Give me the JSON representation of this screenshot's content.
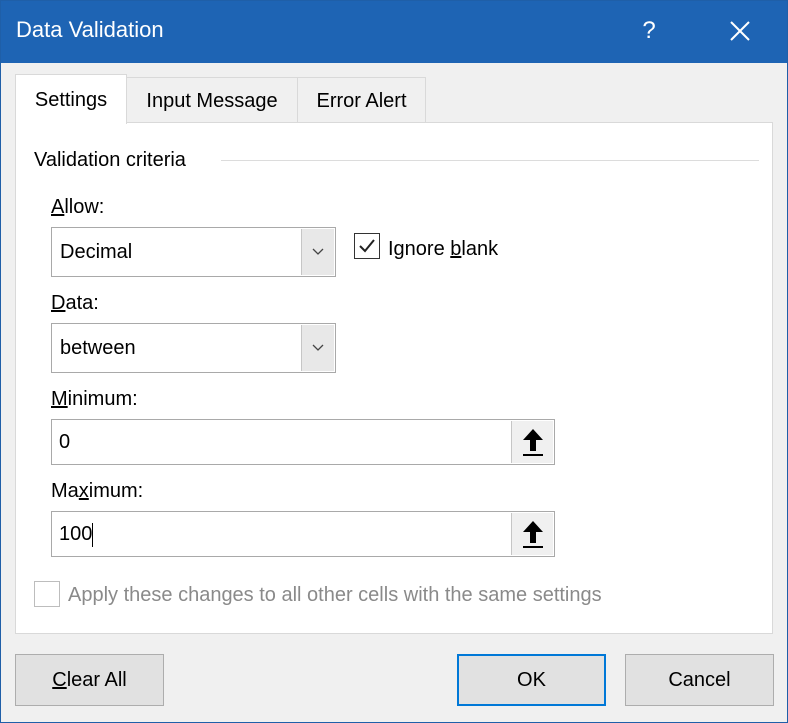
{
  "window": {
    "title": "Data Validation",
    "help_label": "?",
    "close_icon": "close-icon"
  },
  "tabs": [
    {
      "label": "Settings",
      "active": true
    },
    {
      "label": "Input Message",
      "active": false
    },
    {
      "label": "Error Alert",
      "active": false
    }
  ],
  "settings": {
    "group_label": "Validation criteria",
    "allow": {
      "label_u": "A",
      "label_rest": "llow:",
      "value": "Decimal"
    },
    "ignore_blank": {
      "label_pre": "Ignore ",
      "label_u": "b",
      "label_post": "lank",
      "checked": true
    },
    "data": {
      "label_u": "D",
      "label_rest": "ata:",
      "value": "between"
    },
    "minimum": {
      "label_u": "M",
      "label_rest": "inimum:",
      "value": "0"
    },
    "maximum": {
      "label_pre": "Ma",
      "label_u": "x",
      "label_post": "imum:",
      "value": "100"
    },
    "apply_all": {
      "label": "Apply these changes to all other cells with the same settings",
      "checked": false
    }
  },
  "buttons": {
    "clear_u": "C",
    "clear_rest": "lear All",
    "ok": "OK",
    "cancel": "Cancel"
  },
  "colors": {
    "titlebar": "#1e64b4",
    "ok_border": "#0078d7"
  }
}
